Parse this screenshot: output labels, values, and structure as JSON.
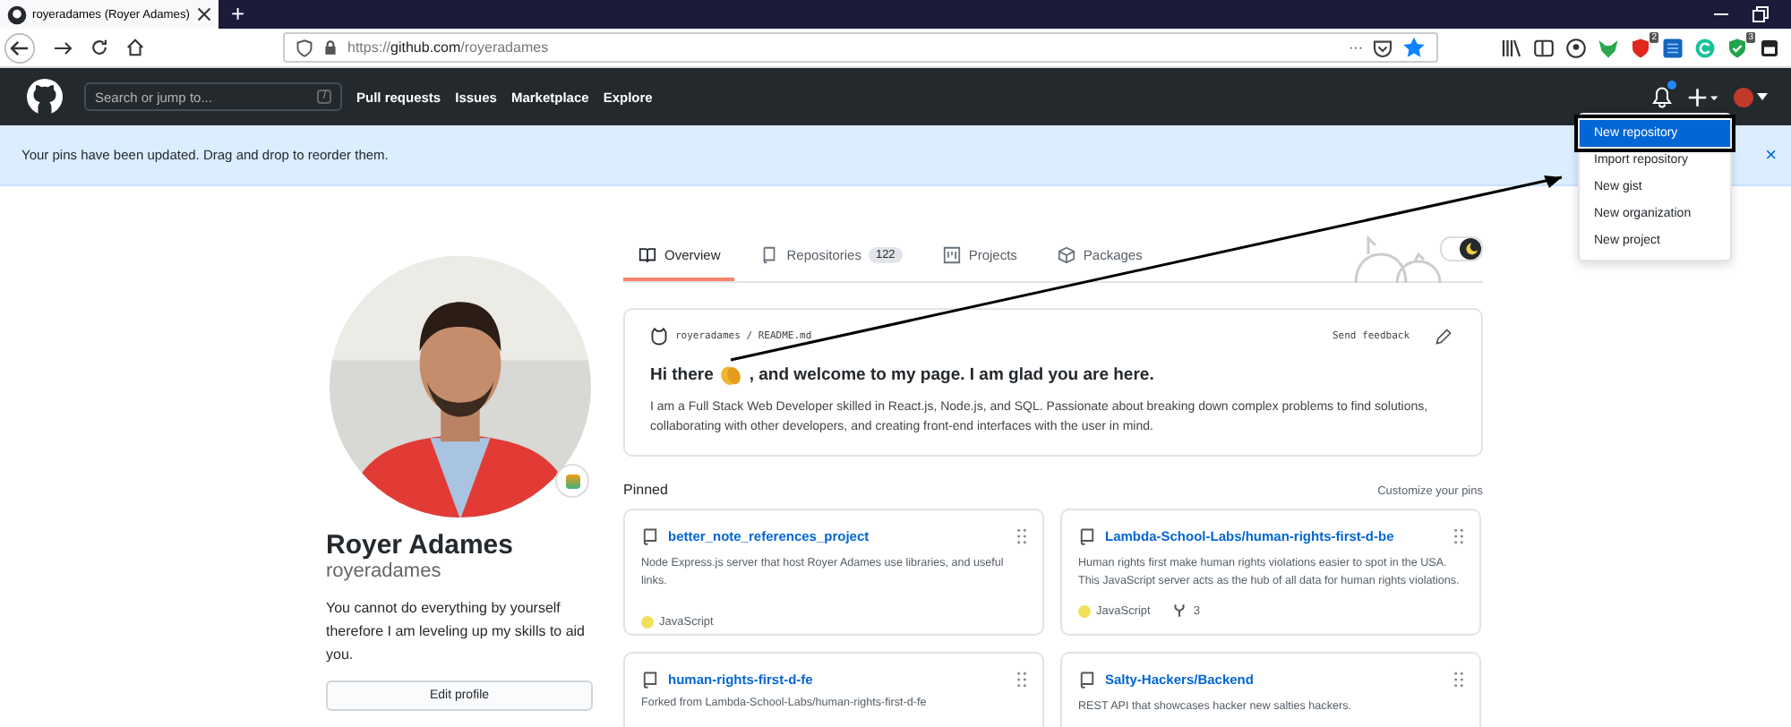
{
  "browser": {
    "tab_title": "royeradames (Royer Adames)",
    "new_tab": "+",
    "url_prefix": "https://",
    "url_host": "github.com",
    "url_path": "/royeradames",
    "page_menu": "···",
    "badges": [
      "2",
      "3"
    ]
  },
  "header": {
    "search": {
      "placeholder": "Search or jump to...",
      "shortcut": "/"
    },
    "nav": [
      "Pull requests",
      "Issues",
      "Marketplace",
      "Explore"
    ],
    "notification": true
  },
  "banner": {
    "text": "Your pins have been updated. Drag and drop to reorder them.",
    "close": "×"
  },
  "menu": [
    {
      "label": "New repository",
      "selected": true
    },
    {
      "label": "Import repository",
      "selected": false
    },
    {
      "label": "New gist",
      "selected": false
    },
    {
      "label": "New organization",
      "selected": false
    },
    {
      "label": "New project",
      "selected": false
    }
  ],
  "profile": {
    "name": "Royer Adames",
    "login": "royeradames",
    "bio": "You cannot do everything by yourself therefore I am leveling up my skills to aid you.",
    "edit": "Edit profile"
  },
  "tabs": [
    {
      "label": "Overview",
      "selected": true,
      "kind": "book"
    },
    {
      "label": "Repositories",
      "count": "122",
      "selected": false,
      "kind": "repo"
    },
    {
      "label": "Projects",
      "selected": false,
      "kind": "project"
    },
    {
      "label": "Packages",
      "selected": false,
      "kind": "package"
    }
  ],
  "dark_mode": {
    "on": true
  },
  "readme": {
    "user": "royeradames",
    "sep": "/",
    "file": "README.md",
    "feedback": "Send feedback",
    "heading_before": "Hi there",
    "heading_after": ", and welcome to my page. I am glad you are here.",
    "body": "I am a Full Stack Web Developer skilled in React.js, Node.js, and SQL. Passionate about breaking down complex problems to find solutions, collaborating with other developers, and creating front-end interfaces with the user in mind."
  },
  "pinned": {
    "title": "Pinned",
    "customize": "Customize your pins",
    "repos": [
      {
        "name": "better_note_references_project",
        "description": "Node Express.js server that host Royer Adames use libraries, and useful links.",
        "language": "JavaScript",
        "color": "#f1e05a"
      },
      {
        "name": "Lambda-School-Labs/human-rights-first-d-be",
        "description": "Human rights first make human rights violations easier to spot in the USA. This JavaScript server acts as the hub of all data for human rights violations.",
        "language": "JavaScript",
        "color": "#f1e05a",
        "forks": "3"
      },
      {
        "name": "human-rights-first-d-fe",
        "forked_from": "Forked from Lambda-School-Labs/human-rights-first-d-fe"
      },
      {
        "name": "Salty-Hackers/Backend",
        "description": "REST API that showcases hacker new salties hackers."
      }
    ]
  }
}
